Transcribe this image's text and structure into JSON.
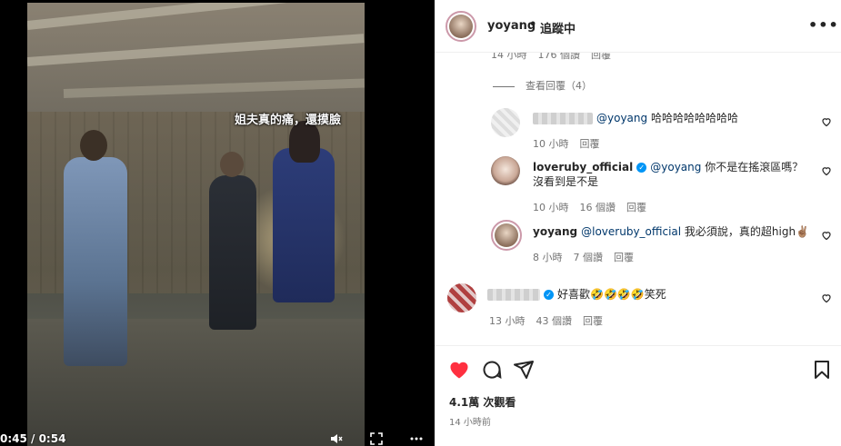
{
  "video": {
    "caption": "姐夫真的痛，還摸臉",
    "timecode": "0:45 / 0:54",
    "mute_icon": "speaker-muted-icon",
    "fullscreen_icon": "fullscreen-icon",
    "more_icon": "more-icon"
  },
  "header": {
    "username": "yoyang",
    "separator": "•",
    "follow_status": "追蹤中",
    "more": "•••"
  },
  "comments": {
    "top_meta": {
      "time": "14 小時",
      "likes": "176 個讚",
      "reply": "回覆"
    },
    "view_replies": "查看回覆（4）",
    "items": [
      {
        "mention": "@yoyang",
        "text": " 哈哈哈哈哈哈哈哈",
        "time": "10 小時",
        "reply": "回覆"
      },
      {
        "user": "loveruby_official",
        "mention": "@yoyang",
        "text": " 你不是在搖滾區嗎？沒看到是不是",
        "time": "10 小時",
        "likes": "16 個讚",
        "reply": "回覆"
      },
      {
        "user": "yoyang",
        "mention": "@loveruby_official",
        "text": " 我必須說，真的超high✌🏽",
        "time": "8 小時",
        "likes": "7 個讚",
        "reply": "回覆"
      },
      {
        "text": "好喜歡🤣🤣🤣🤣笑死",
        "time": "13 小時",
        "likes": "43 個讚",
        "reply": "回覆"
      }
    ]
  },
  "actions": {
    "likes": "4.1萬 次觀看",
    "time": "14 小時前"
  },
  "colors": {
    "like_red": "#ff3040",
    "mention_blue": "#00376b",
    "verified_blue": "#0095f6"
  }
}
